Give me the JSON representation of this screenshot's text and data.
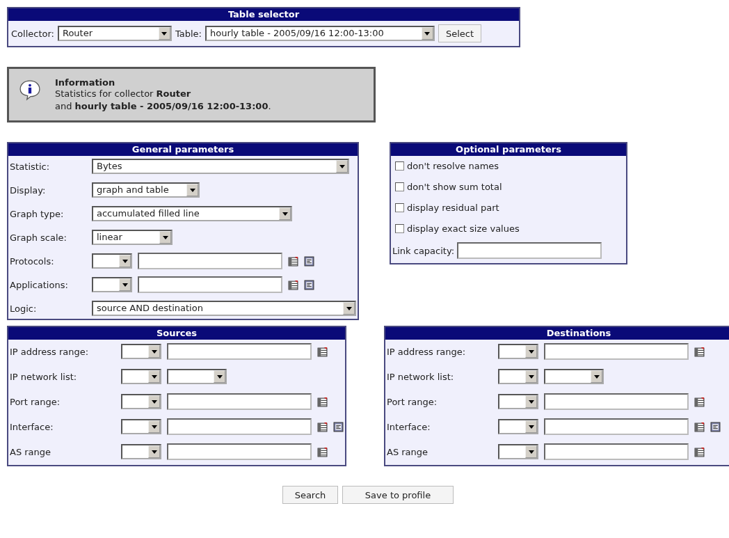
{
  "table_selector": {
    "title": "Table selector",
    "collector": {
      "label": "Collector:",
      "value": "Router"
    },
    "table": {
      "label": "Table:",
      "value": "hourly table - 2005/09/16 12:00-13:00"
    },
    "button": "Select"
  },
  "information": {
    "title": "Information",
    "lines": [
      "Statistics for collector **Router**",
      "and **hourly table - 2005/09/16 12:00-13:00**."
    ]
  },
  "general_parameters": {
    "title": "General parameters",
    "rows": [
      {
        "label": "Statistic:",
        "kind": "select",
        "value": "Bytes"
      },
      {
        "label": "Display:",
        "kind": "select",
        "value": "graph and table"
      },
      {
        "label": "Graph type:",
        "kind": "select",
        "value": "accumulated filled line"
      },
      {
        "label": "Graph scale:",
        "kind": "select",
        "value": "linear"
      },
      {
        "label": "Protocols:",
        "kind": "range",
        "icons": [
          {
            "kind": "table"
          },
          {
            "kind": "list"
          }
        ]
      },
      {
        "label": "Applications:",
        "kind": "range",
        "icons": [
          {
            "kind": "table"
          },
          {
            "kind": "list"
          }
        ]
      },
      {
        "label": "Logic:",
        "kind": "select",
        "value": "source AND destination"
      }
    ]
  },
  "optional_parameters": {
    "title": "Optional parameters",
    "options": [
      {
        "label": "don't resolve names",
        "checked": false
      },
      {
        "label": "don't show sum total",
        "checked": false
      },
      {
        "label": "display residual part",
        "checked": false
      },
      {
        "label": "display exact size values",
        "checked": false
      }
    ],
    "link_capacity": {
      "label": "Link capacity:"
    }
  },
  "sources": {
    "title": "Sources",
    "rows": [
      {
        "label": "IP address range:",
        "kind": "range",
        "icons": [
          {
            "kind": "table"
          }
        ]
      },
      {
        "label": "IP network list:",
        "kind": "lists"
      },
      {
        "label": "Port range:",
        "kind": "range",
        "icons": [
          {
            "kind": "table"
          }
        ]
      },
      {
        "label": "Interface:",
        "kind": "range",
        "icons": [
          {
            "kind": "table"
          },
          {
            "kind": "list"
          }
        ]
      },
      {
        "label": "AS range",
        "kind": "range",
        "icons": [
          {
            "kind": "table"
          }
        ]
      }
    ]
  },
  "destinations": {
    "title": "Destinations",
    "rows": [
      {
        "label": "IP address range:",
        "kind": "range",
        "icons": [
          {
            "kind": "table"
          }
        ]
      },
      {
        "label": "IP network list:",
        "kind": "lists"
      },
      {
        "label": "Port range:",
        "kind": "range",
        "icons": [
          {
            "kind": "table"
          }
        ]
      },
      {
        "label": "Interface:",
        "kind": "range",
        "icons": [
          {
            "kind": "table"
          },
          {
            "kind": "list"
          }
        ]
      },
      {
        "label": "AS range",
        "kind": "range",
        "icons": [
          {
            "kind": "table"
          }
        ]
      }
    ]
  },
  "buttons": [
    "Search",
    "Save to profile"
  ]
}
